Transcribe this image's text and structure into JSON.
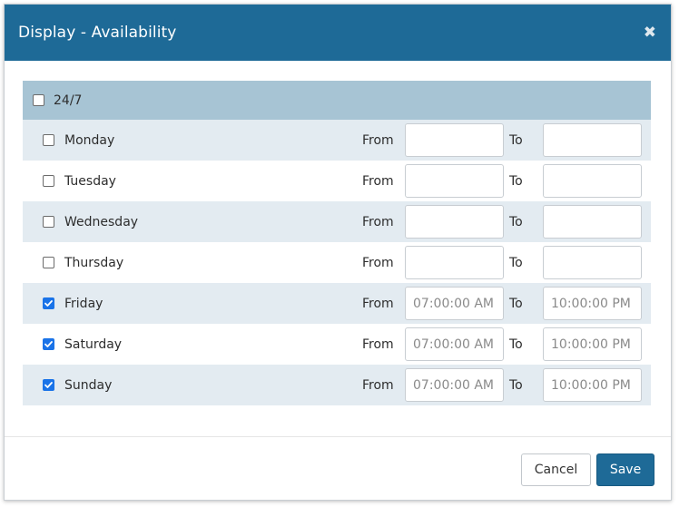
{
  "dialog": {
    "title": "Display - Availability",
    "close_symbol": "✖"
  },
  "always": {
    "label": "24/7",
    "checked": false
  },
  "labels": {
    "from": "From",
    "to": "To"
  },
  "days": [
    {
      "name": "Monday",
      "checked": false,
      "from": "",
      "to": ""
    },
    {
      "name": "Tuesday",
      "checked": false,
      "from": "",
      "to": ""
    },
    {
      "name": "Wednesday",
      "checked": false,
      "from": "",
      "to": ""
    },
    {
      "name": "Thursday",
      "checked": false,
      "from": "",
      "to": ""
    },
    {
      "name": "Friday",
      "checked": true,
      "from": "07:00:00 AM",
      "to": "10:00:00 PM"
    },
    {
      "name": "Saturday",
      "checked": true,
      "from": "07:00:00 AM",
      "to": "10:00:00 PM"
    },
    {
      "name": "Sunday",
      "checked": true,
      "from": "07:00:00 AM",
      "to": "10:00:00 PM"
    }
  ],
  "footer": {
    "cancel_label": "Cancel",
    "save_label": "Save"
  },
  "colors": {
    "header": "#1e6a97",
    "checkbox_checked": "#1a73e8"
  }
}
